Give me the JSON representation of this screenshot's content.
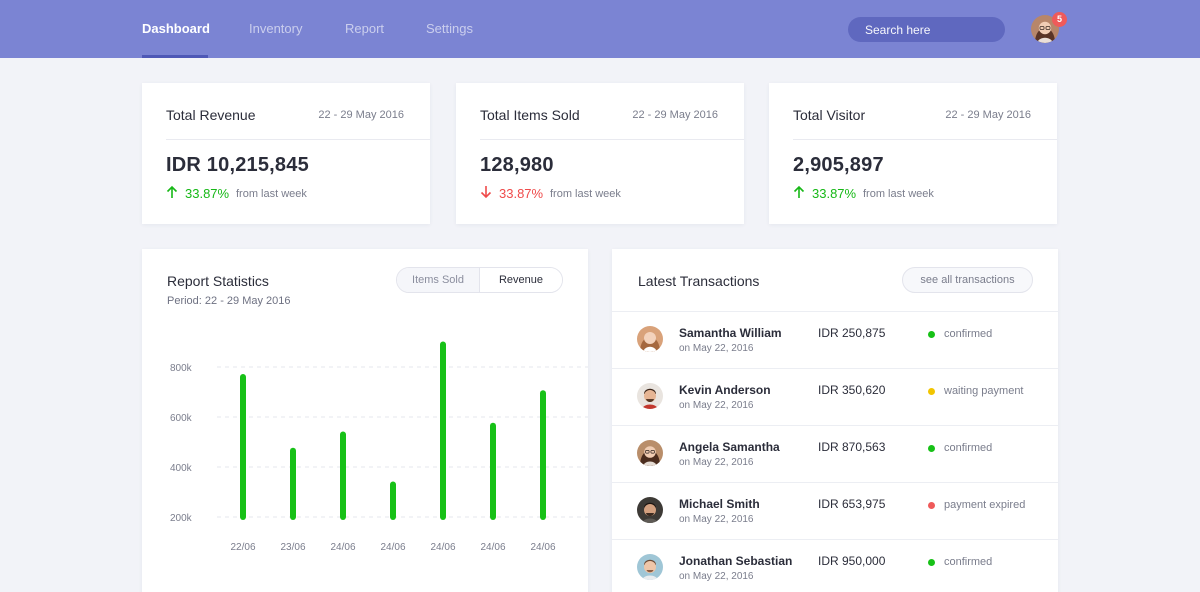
{
  "nav": {
    "items": [
      {
        "label": "Dashboard",
        "active": true
      },
      {
        "label": "Inventory",
        "active": false
      },
      {
        "label": "Report",
        "active": false
      },
      {
        "label": "Settings",
        "active": false
      }
    ],
    "search_placeholder": "Search here",
    "notification_count": "5"
  },
  "stats": [
    {
      "title": "Total Revenue",
      "date": "22 - 29 May 2016",
      "value": "IDR 10,215,845",
      "change": "33.87%",
      "direction": "up",
      "from": "from last week"
    },
    {
      "title": "Total Items Sold",
      "date": "22 - 29 May 2016",
      "value": "128,980",
      "change": "33.87%",
      "direction": "down",
      "from": "from last week"
    },
    {
      "title": "Total Visitor",
      "date": "22 - 29 May 2016",
      "value": "2,905,897",
      "change": "33.87%",
      "direction": "up",
      "from": "from last week"
    }
  ],
  "report": {
    "title": "Report Statistics",
    "period": "Period: 22 - 29 May 2016",
    "tabs": {
      "items_sold": "Items Sold",
      "revenue": "Revenue"
    },
    "active_tab": "revenue"
  },
  "chart_data": {
    "type": "bar",
    "categories": [
      "22/06",
      "23/06",
      "24/06",
      "24/06",
      "24/06",
      "24/06",
      "24/06"
    ],
    "values": [
      760000,
      465000,
      530000,
      330000,
      890000,
      565000,
      695000
    ],
    "ylim": [
      200000,
      900000
    ],
    "yticks": [
      "200k",
      "400k",
      "600k",
      "800k"
    ],
    "ytick_values": [
      200000,
      400000,
      600000,
      800000
    ],
    "bar_color": "#17c117",
    "grid": "dashed horizontal"
  },
  "transactions": {
    "title": "Latest Transactions",
    "see_all": "see all transactions",
    "rows": [
      {
        "name": "Samantha William",
        "date": "on May 22, 2016",
        "amount": "IDR 250,875",
        "status": "confirmed",
        "status_color": "#17c117"
      },
      {
        "name": "Kevin Anderson",
        "date": "on May 22, 2016",
        "amount": "IDR 350,620",
        "status": "waiting payment",
        "status_color": "#f2c500"
      },
      {
        "name": "Angela Samantha",
        "date": "on May 22, 2016",
        "amount": "IDR 870,563",
        "status": "confirmed",
        "status_color": "#17c117"
      },
      {
        "name": "Michael Smith",
        "date": "on May 22, 2016",
        "amount": "IDR 653,975",
        "status": "payment expired",
        "status_color": "#ef5a5a"
      },
      {
        "name": "Jonathan Sebastian",
        "date": "on May 22, 2016",
        "amount": "IDR 950,000",
        "status": "confirmed",
        "status_color": "#17c117"
      }
    ]
  },
  "colors": {
    "topbar": "#7b84d3",
    "accent_up": "#17b817",
    "accent_down": "#ef4b4b"
  }
}
